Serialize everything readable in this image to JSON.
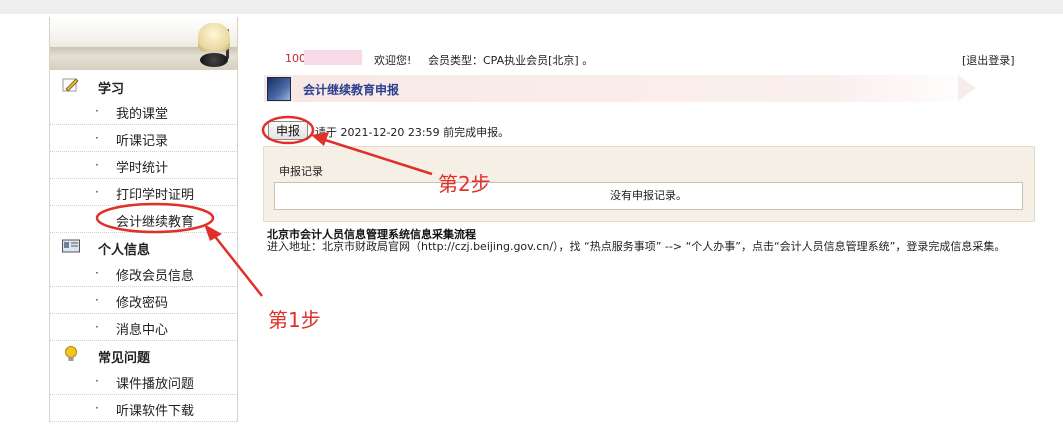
{
  "sidebar": {
    "sections": [
      {
        "title": "学习",
        "icon": "pencil-icon",
        "items": [
          "我的课堂",
          "听课记录",
          "学时统计",
          "打印学时证明",
          "会计继续教育"
        ]
      },
      {
        "title": "个人信息",
        "icon": "id-card-icon",
        "items": [
          "修改会员信息",
          "修改密码",
          "消息中心"
        ]
      },
      {
        "title": "常见问题",
        "icon": "lightbulb-icon",
        "items": [
          "课件播放问题",
          "听课软件下载"
        ]
      }
    ],
    "bullet": "·"
  },
  "header": {
    "user_id_prefix": "100",
    "welcome": "欢迎您!",
    "member_type": "会员类型：CPA执业会员[北京] 。",
    "logout": "[退出登录]"
  },
  "page": {
    "title": "会计继续教育申报",
    "apply_button": "申报",
    "deadline_text": "请于 2021-12-20 23:59 前完成申报。",
    "records_title": "申报记录",
    "no_records": "没有申报记录。"
  },
  "process": {
    "title": "北京市会计人员信息管理系统信息采集流程",
    "text": "进入地址：北京市财政局官网（http://czj.beijing.gov.cn/），找 “热点服务事项” --> “个人办事”，点击“会计人员信息管理系统”，登录完成信息采集。"
  },
  "annotations": {
    "step1": "第1步",
    "step2": "第2步",
    "color": "#e0302a"
  }
}
